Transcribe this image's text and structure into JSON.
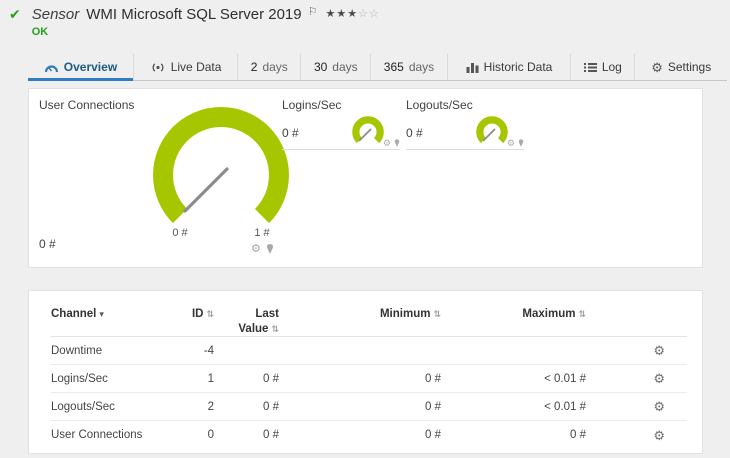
{
  "colors": {
    "gauge_green": "#a6c700",
    "status_ok_green": "#23a117",
    "active_tab_blue": "#2f7ec1"
  },
  "icons": {
    "check": "✔",
    "flag": "⚐",
    "gear": "⚙",
    "sort": "⇅",
    "sort_desc": "▾"
  },
  "header": {
    "kind": "Sensor",
    "title": "WMI Microsoft SQL Server 2019",
    "status": "OK",
    "stars_filled": "★★★",
    "stars_empty": "☆☆"
  },
  "tabs": {
    "overview": "Overview",
    "live": "Live Data",
    "d2_num": "2",
    "d2_unit": "days",
    "d30_num": "30",
    "d30_unit": "days",
    "d365_num": "365",
    "d365_unit": "days",
    "historic": "Historic Data",
    "log": "Log",
    "settings": "Settings"
  },
  "gauges": {
    "primary": {
      "title": "User Connections",
      "value": "0 #",
      "min": "0 #",
      "max": "1 #"
    },
    "logins": {
      "title": "Logins/Sec",
      "value": "0 #"
    },
    "logouts": {
      "title": "Logouts/Sec",
      "value": "0 #"
    }
  },
  "table": {
    "headers": {
      "channel": "Channel",
      "id": "ID",
      "last": "Last Value",
      "min": "Minimum",
      "max": "Maximum"
    },
    "rows": [
      {
        "channel": "Downtime",
        "id": "-4",
        "last": "",
        "min": "",
        "max": ""
      },
      {
        "channel": "Logins/Sec",
        "id": "1",
        "last": "0 #",
        "min": "0 #",
        "max": "< 0.01 #"
      },
      {
        "channel": "Logouts/Sec",
        "id": "2",
        "last": "0 #",
        "min": "0 #",
        "max": "< 0.01 #"
      },
      {
        "channel": "User Connections",
        "id": "0",
        "last": "0 #",
        "min": "0 #",
        "max": "0 #"
      }
    ]
  }
}
